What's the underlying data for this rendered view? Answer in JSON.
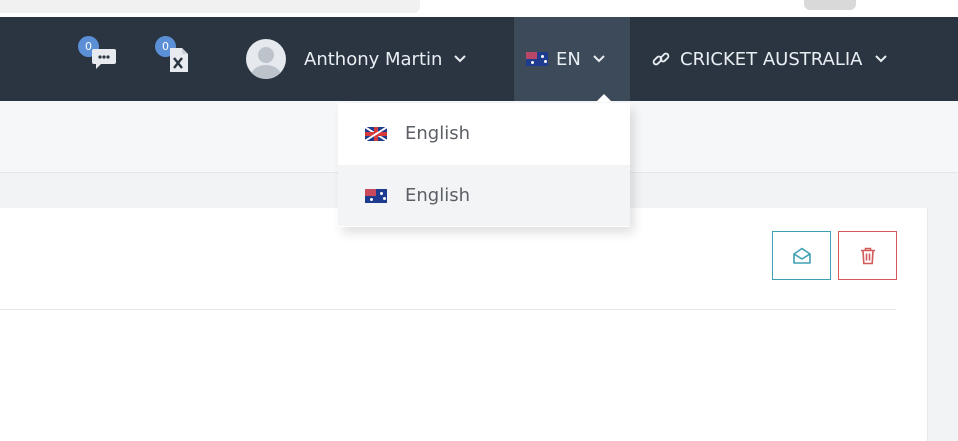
{
  "navbar": {
    "chat_notifications": {
      "count": "0",
      "icon": "chat-bubble-icon"
    },
    "file_notifications": {
      "count": "0",
      "icon": "excel-file-icon"
    },
    "user": {
      "name": "Anthony Martin",
      "avatar_icon": "user-avatar-icon"
    },
    "language": {
      "code": "EN",
      "flag": "au-flag-icon"
    },
    "organization": {
      "name": "CRICKET AUSTRALIA",
      "icon": "link-icon"
    }
  },
  "language_dropdown": {
    "items": [
      {
        "label": "English",
        "flag": "uk-flag-icon"
      },
      {
        "label": "English",
        "flag": "au-flag-icon"
      }
    ]
  },
  "card": {
    "actions": [
      {
        "icon": "envelope-open-icon",
        "color": "#3f9fb3"
      },
      {
        "icon": "trash-icon",
        "color": "#d45a5a"
      }
    ]
  },
  "colors": {
    "navbar_bg": "#2b3541",
    "language_active_bg": "#3d4a59",
    "badge": "#5b8fd6"
  }
}
